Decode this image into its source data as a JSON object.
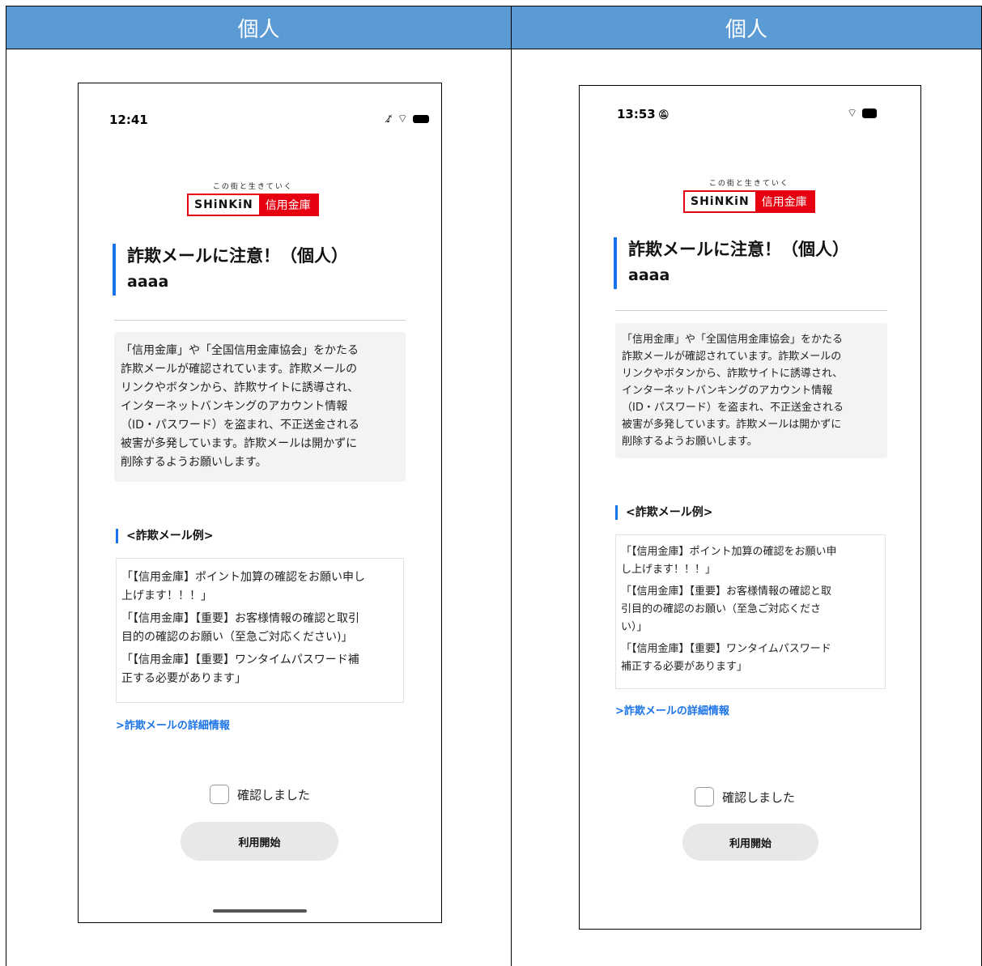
{
  "columns": [
    {
      "header": "個人",
      "phone": {
        "time": "12:41",
        "logo_tagline": "この街と生きていく",
        "logo_en": "SHiNKiN",
        "logo_jp": "信用金庫",
        "title": "詐欺メールに注意！（個人）",
        "subtitle": "aaaa",
        "notice": "「信用金庫」や「全国信用金庫協会」をかたる\n詐欺メールが確認されています。詐欺メールの\nリンクやボタンから、詐欺サイトに誘導され、\nインターネットバンキングのアカウント情報\n（ID・パスワード）を盗まれ、不正送金される\n被害が多発しています。詐欺メールは開かずに\n削除するようお願いします。",
        "examples_heading": "<詐欺メール例>",
        "examples": [
          "「【信用金庫】ポイント加算の確認をお願い申し\n上げます！！！」",
          "「【信用金庫】【重要】お客様情報の確認と取引\n目的の確認のお願い（至急ご対応ください)」",
          "「【信用金庫】【重要】ワンタイムパスワード補\n正する必要があります」"
        ],
        "details_link": ">詐欺メールの詳細情報",
        "checkbox_label": "確認しました",
        "start_button": "利用開始"
      }
    },
    {
      "header": "個人",
      "phone": {
        "time": "13:53",
        "logo_tagline": "この街と生きていく",
        "logo_en": "SHiNKiN",
        "logo_jp": "信用金庫",
        "title": "詐欺メールに注意！（個人）",
        "subtitle": "aaaa",
        "notice": "「信用金庫」や「全国信用金庫協会」をかたる\n詐欺メールが確認されています。詐欺メールの\nリンクやボタンから、詐欺サイトに誘導され、\nインターネットバンキングのアカウント情報\n（ID・パスワード）を盗まれ、不正送金される\n被害が多発しています。詐欺メールは開かずに\n削除するようお願いします。",
        "examples_heading": "<詐欺メール例>",
        "examples": [
          "「【信用金庫】ポイント加算の確認をお願い申\nし上げます！！！」",
          "「【信用金庫】【重要】お客様情報の確認と取\n引目的の確認のお願い（至急ご対応くださ\nい）」",
          "「【信用金庫】【重要】ワンタイムパスワード\n補正する必要があります」"
        ],
        "details_link": ">詐欺メールの詳細情報",
        "checkbox_label": "確認しました",
        "start_button": "利用開始"
      }
    }
  ],
  "colors": {
    "header_bg": "#5b9bd5",
    "accent": "#1a73e8",
    "brand_red": "#e60012"
  }
}
